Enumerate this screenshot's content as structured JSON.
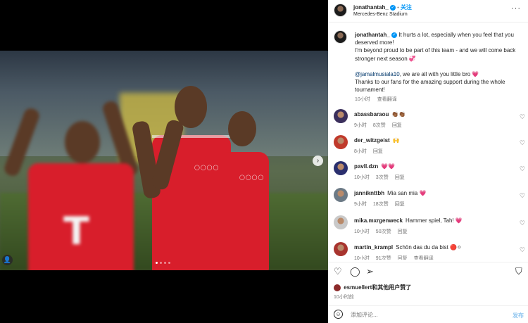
{
  "header": {
    "username": "jonathantah_",
    "follow_label": "关注",
    "follow_separator": "•",
    "location": "Mercedes-Benz Stadium",
    "more_icon": "more-horizontal-icon"
  },
  "caption": {
    "username": "jonathantah_",
    "line1": "It hurts a lot, especially when you feel that you deserved more!",
    "line2": "I'm beyond proud to be part of this team - and we will come back stronger next season 💞",
    "mention": "@jamalmusiala10",
    "line3_rest": ", we are all with you little bro 💗",
    "line4": "Thanks to our fans for the amazing support during the whole tournament!",
    "time": "10小时",
    "translate": "查看翻译"
  },
  "comments": [
    {
      "username": "abassbaraou",
      "text": "👏🏾👏🏾",
      "time": "9小时",
      "likes": "8次赞",
      "reply": "回复",
      "avatar_color": "#3b2f5c"
    },
    {
      "username": "der_witzgeist",
      "text": "🙌",
      "time": "8小时",
      "likes": "",
      "reply": "回复",
      "avatar_color": "#c03a2b"
    },
    {
      "username": "pavll.dzn",
      "text": "💗💗",
      "time": "10小时",
      "likes": "3次赞",
      "reply": "回复",
      "avatar_color": "#2a2f6e"
    },
    {
      "username": "janniknttbh",
      "text": "Mia san mia 💗",
      "time": "9小时",
      "likes": "18次赞",
      "reply": "回复",
      "avatar_color": "#6c7a86"
    },
    {
      "username": "mika.mxrgenweck",
      "text": "Hammer spiel, Tah! 💗",
      "time": "10小时",
      "likes": "50次赞",
      "reply": "回复",
      "avatar_color": "#c9c9c9"
    },
    {
      "username": "martin_krampl",
      "text": "Schön das du da bist 🔴⚪",
      "time": "10小时",
      "likes": "91次赞",
      "reply": "回复",
      "translate": "查看翻译",
      "avatar_color": "#a8342e"
    }
  ],
  "actions": {
    "like_icon": "heart-outline-icon",
    "comment_icon": "comment-icon",
    "share_icon": "send-icon",
    "save_icon": "bookmark-icon"
  },
  "likes_summary": {
    "username": "esmuellert",
    "text": "和其他用户赞了"
  },
  "post_time": "10小时前",
  "composer": {
    "placeholder": "添加评论...",
    "post_label": "发布",
    "emoji_icon": "smiley-icon"
  },
  "media": {
    "carousel_total": 4,
    "carousel_active": 1,
    "next_icon": "chevron-right-icon",
    "tags_icon": "user-tag-icon"
  },
  "colors": {
    "accent": "#0095f6",
    "mention": "#00376b",
    "muted": "#737373",
    "jersey_red": "#d81e2b"
  }
}
